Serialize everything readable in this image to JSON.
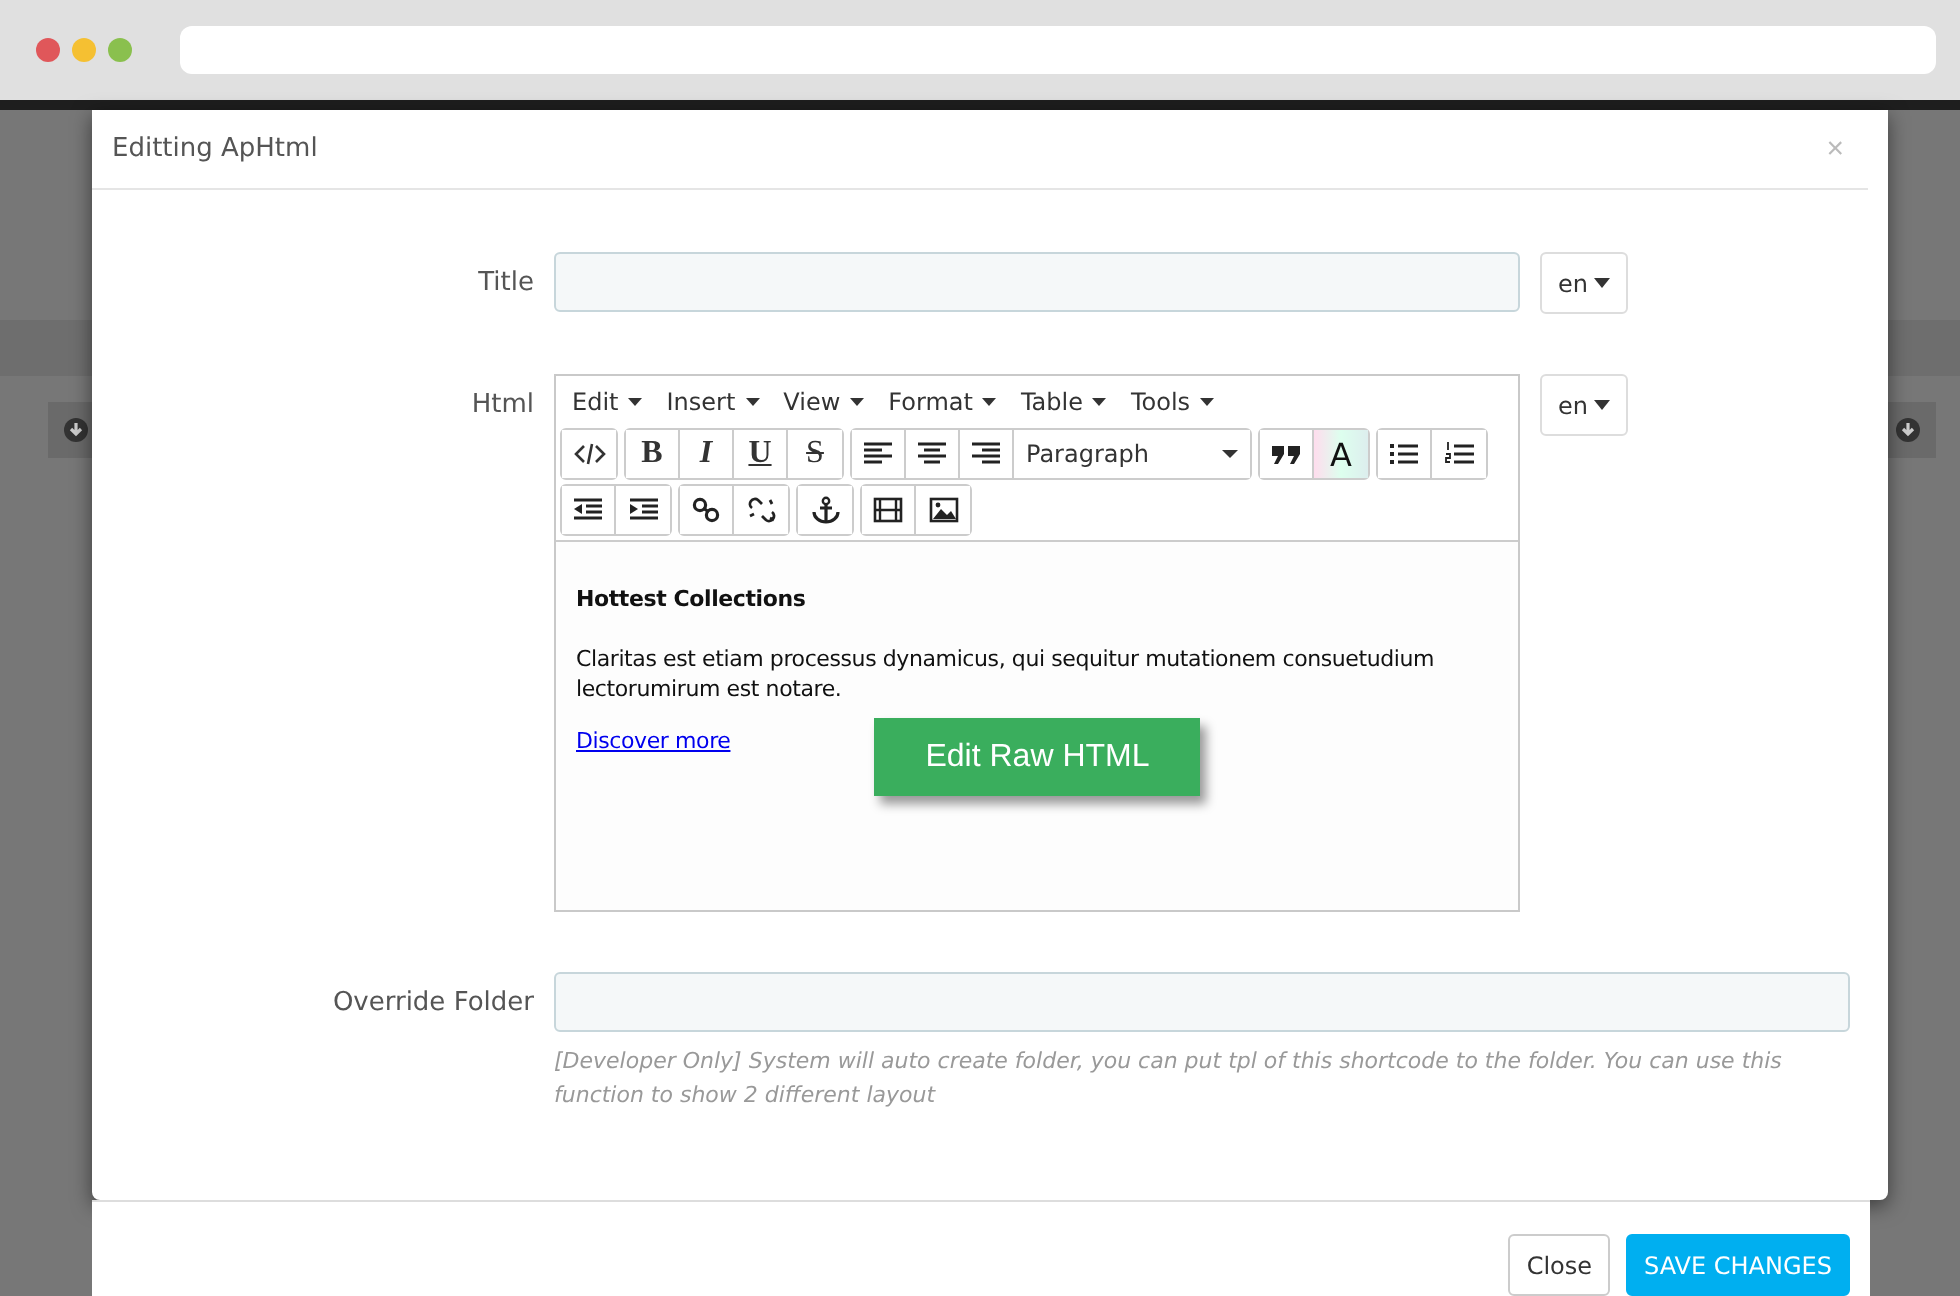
{
  "dialog": {
    "title": "Editting ApHtml",
    "close": "×"
  },
  "fields": [
    {
      "kind": "input",
      "label": "Title",
      "lang": "en"
    },
    {
      "kind": "editor",
      "label": "Html",
      "lang": "en"
    },
    {
      "kind": "input",
      "label": "Override Folder",
      "help": "[Developer Only] System will auto create folder, you can put tpl of this shortcode to the folder. You can use this function to show 2 different layout"
    }
  ],
  "editor": {
    "menus": [
      "Edit",
      "Insert",
      "View",
      "Format",
      "Table",
      "Tools"
    ],
    "toolbar_rows": [
      [
        [
          {
            "kind": "code"
          }
        ],
        [
          {
            "kind": "bold",
            "label": "B"
          },
          {
            "kind": "italic",
            "label": "I"
          },
          {
            "kind": "underline",
            "label": "U"
          },
          {
            "kind": "strike",
            "label": "S"
          }
        ],
        [
          {
            "kind": "align-left"
          },
          {
            "kind": "align-center"
          },
          {
            "kind": "align-right"
          },
          {
            "kind": "select",
            "label": "Paragraph"
          }
        ],
        [
          {
            "kind": "quote"
          },
          {
            "kind": "text-color",
            "label": "A"
          }
        ],
        [
          {
            "kind": "bullet-list"
          },
          {
            "kind": "number-list"
          }
        ]
      ],
      [
        [
          {
            "kind": "outdent"
          },
          {
            "kind": "indent"
          }
        ],
        [
          {
            "kind": "link"
          },
          {
            "kind": "unlink"
          }
        ],
        [
          {
            "kind": "anchor"
          }
        ],
        [
          {
            "kind": "video"
          },
          {
            "kind": "image"
          }
        ]
      ]
    ],
    "heading": "Hottest Collections",
    "paragraph": "Claritas est etiam processus dynamicus, qui sequitur mutationem consuetudium lectorumirum est notare.",
    "link": "Discover more",
    "raw_button": "Edit Raw HTML"
  },
  "footer": {
    "buttons": [
      {
        "kind": "default",
        "label": "Close"
      },
      {
        "kind": "primary",
        "label": "SAVE CHANGES"
      }
    ]
  }
}
